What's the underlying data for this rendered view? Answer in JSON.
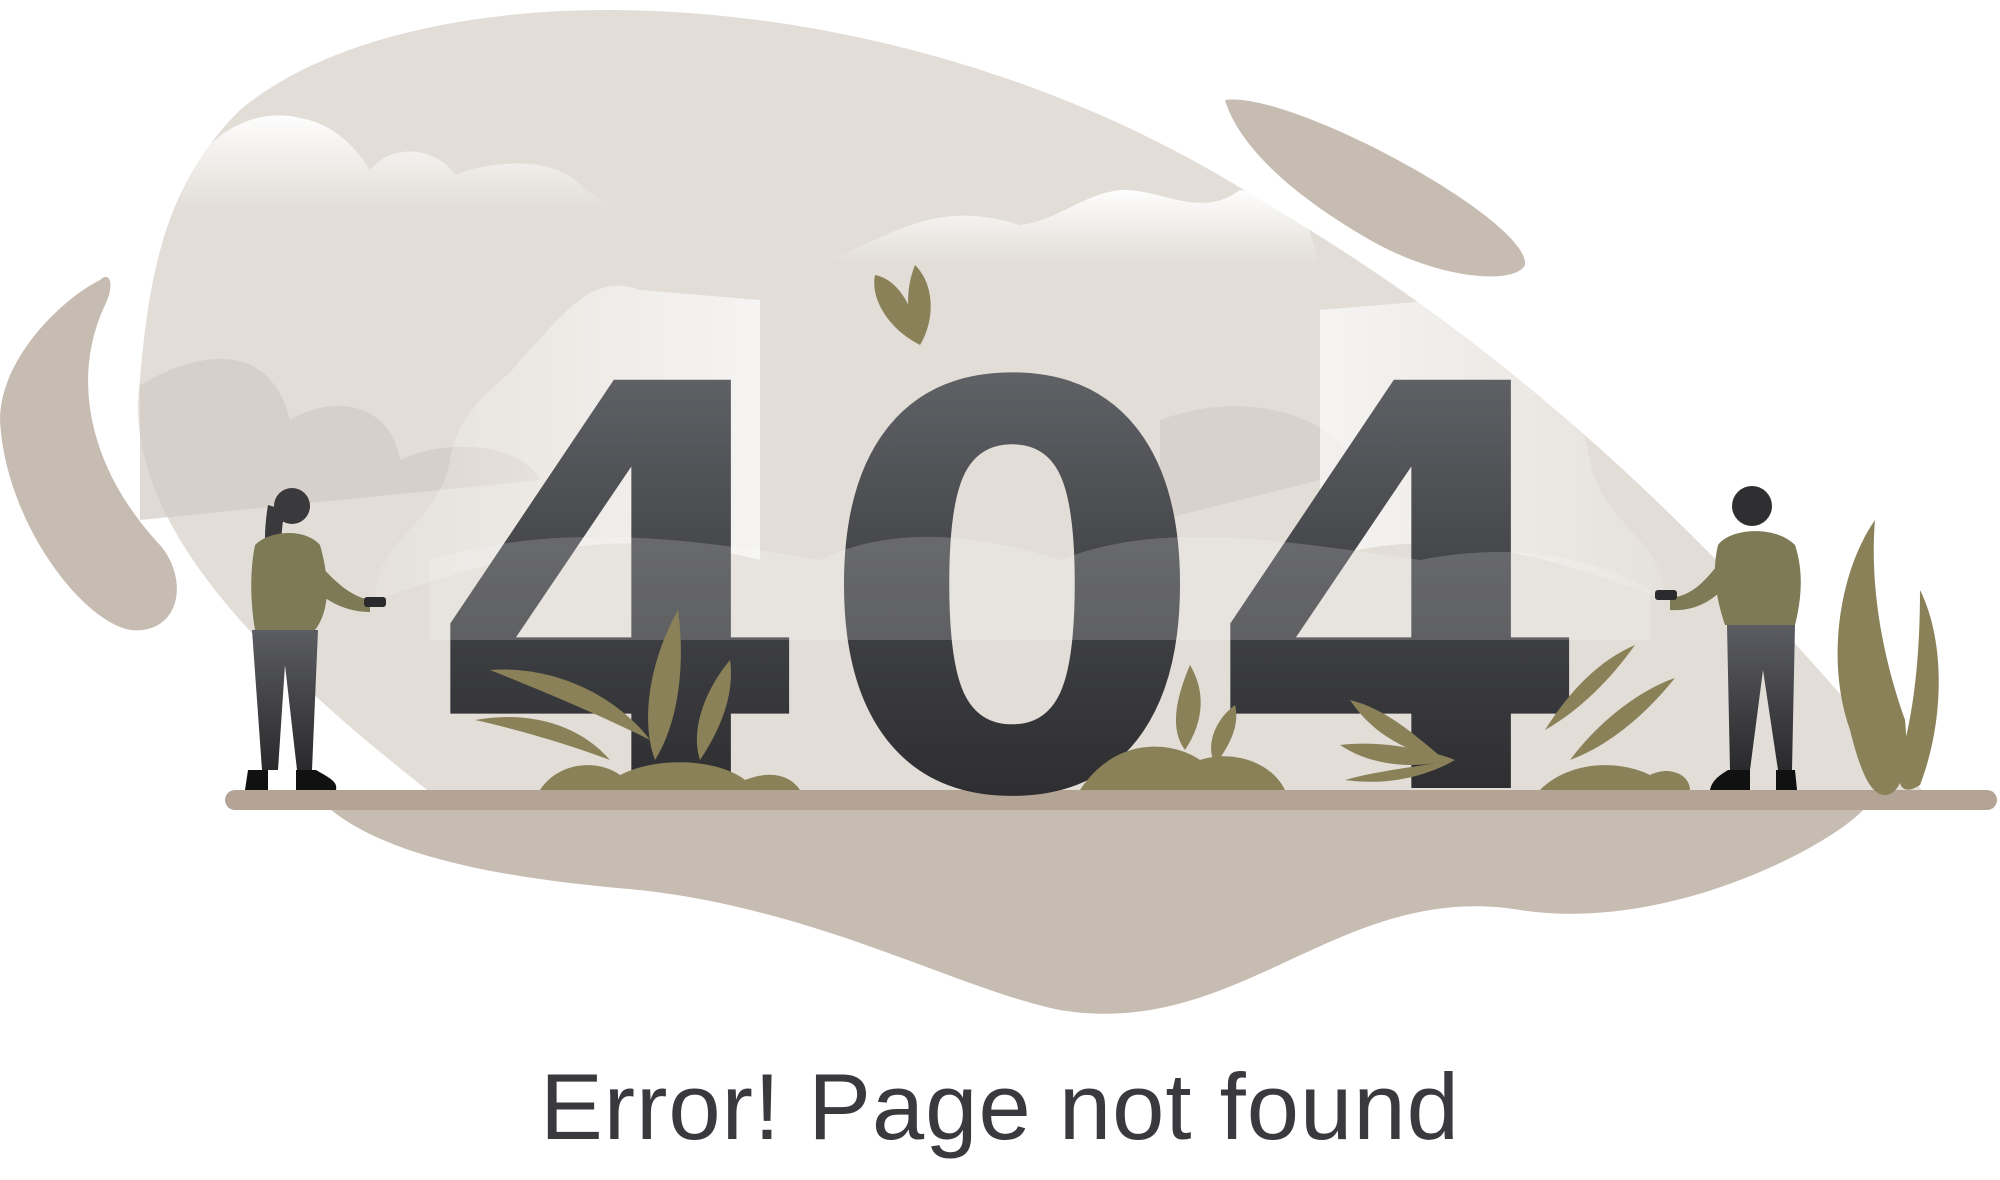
{
  "error": {
    "code_digits": [
      "4",
      "0",
      "4"
    ],
    "message": "Error! Page not found"
  },
  "colors": {
    "background": "#ffffff",
    "blob_light": "#e2ddd7",
    "blob_dark": "#c7bcb1",
    "ground": "#b3a496",
    "digit_top": "#6b6d72",
    "digit_bottom": "#232325",
    "foliage": "#8a8158",
    "shirt": "#7d7a55",
    "text": "#3a3a3e"
  },
  "icons": [
    "flashlight-icon",
    "plant-icon",
    "cloud-icon"
  ]
}
